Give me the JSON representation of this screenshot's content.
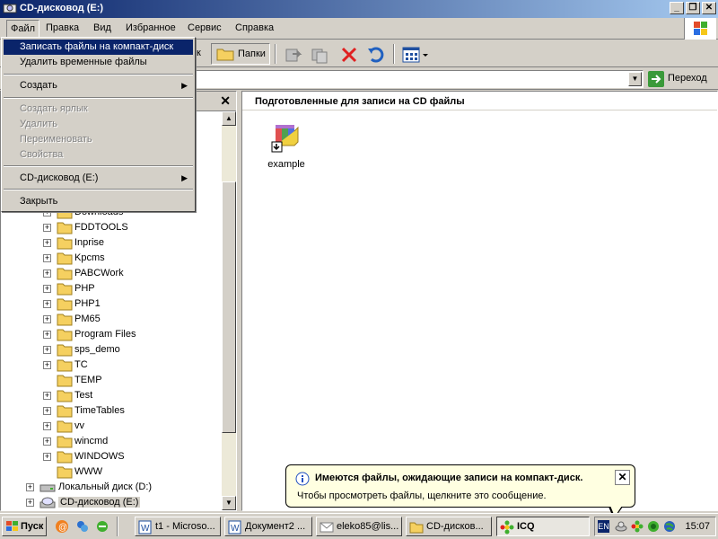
{
  "window": {
    "title": "CD-дисковод (E:)",
    "buttons": {
      "minimize": "_",
      "maximize": "❐",
      "close": "✕"
    }
  },
  "menubar": {
    "items": [
      {
        "label": "Файл",
        "active": true
      },
      {
        "label": "Правка"
      },
      {
        "label": "Вид"
      },
      {
        "label": "Избранное"
      },
      {
        "label": "Сервис"
      },
      {
        "label": "Справка"
      }
    ]
  },
  "toolbar": {
    "partial_text": "к",
    "folders_label": "Папки"
  },
  "addressbar": {
    "go_label": "Переход"
  },
  "file_menu": {
    "items": [
      {
        "label": "Записать файлы на компакт-диск",
        "highlighted": true
      },
      {
        "label": "Удалить временные файлы"
      },
      {
        "label": "Создать",
        "submenu": true
      },
      {
        "label": "Создать ярлык",
        "disabled": true
      },
      {
        "label": "Удалить",
        "disabled": true
      },
      {
        "label": "Переименовать",
        "disabled": true
      },
      {
        "label": "Свойства",
        "disabled": true
      },
      {
        "label": "CD-дисковод (E:)",
        "submenu": true
      },
      {
        "label": "Закрыть"
      }
    ]
  },
  "left_pane": {
    "close_icon": "✕",
    "folders": [
      "Downloads",
      "FDDTOOLS",
      "Inprise",
      "Kpcms",
      "PABCWork",
      "PHP",
      "PHP1",
      "PM65",
      "Program Files",
      "sps_demo",
      "TC",
      "TEMP",
      "Test",
      "TimeTables",
      "vv",
      "wincmd",
      "WINDOWS",
      "WWW"
    ],
    "drives": [
      "Локальный диск (D:)",
      "CD-дисковод (E:)"
    ]
  },
  "right_pane": {
    "header": "Подготовленные для записи на CD файлы",
    "files": [
      {
        "name": "example"
      }
    ]
  },
  "balloon": {
    "title": "Имеются файлы, ожидающие записи на компакт-диск.",
    "text": "Чтобы просмотреть файлы, щелкните это сообщение."
  },
  "taskbar": {
    "start_label": "Пуск",
    "tasks": [
      {
        "label": "t1 - Microso..."
      },
      {
        "label": "Документ2 ..."
      },
      {
        "label": "eleko85@lis..."
      },
      {
        "label": "CD-дисков..."
      },
      {
        "label": "ICQ",
        "active": true
      }
    ],
    "tray": {
      "lang": "EN",
      "clock": "15:07"
    }
  },
  "colors": {
    "titlebar_start": "#0a246a",
    "titlebar_end": "#a6caf0",
    "face": "#d4d0c8",
    "highlight": "#0a246a",
    "tooltip_bg": "#ffffe1",
    "delete_red": "#e02020",
    "folder_yellow": "#f5d060"
  }
}
